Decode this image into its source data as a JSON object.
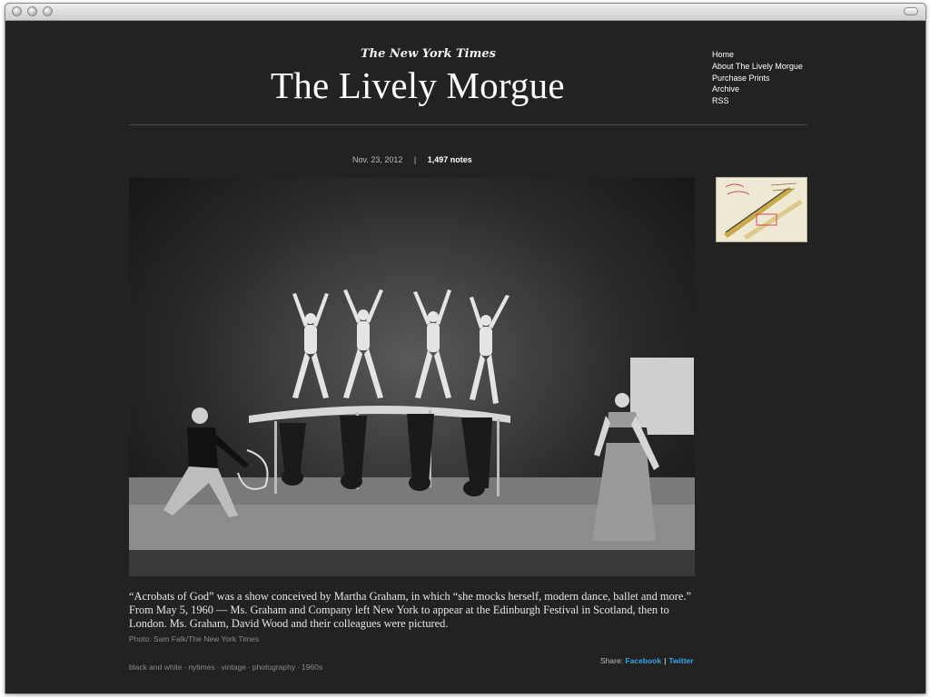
{
  "window": {
    "title": ""
  },
  "header": {
    "logo_text": "The New York Times",
    "site_title": "The Lively Morgue",
    "nav": [
      {
        "label": "Home"
      },
      {
        "label": "About The Lively Morgue"
      },
      {
        "label": "Purchase Prints"
      },
      {
        "label": "Archive"
      },
      {
        "label": "RSS"
      }
    ]
  },
  "post": {
    "date": "Nov. 23, 2012",
    "separator": "|",
    "notes": "1,497 notes",
    "caption": "“Acrobats of God” was a show conceived by Martha Graham, in which “she mocks herself, modern dance, ballet and more.” From May 5, 1960 — Ms. Graham and Company left New York to appear at the Edinburgh Festival in Scotland, then to London. Ms. Graham, David Wood and their colleagues were pictured.",
    "credit": "Photo: Sam Falk/The New York Times",
    "share": {
      "label": "Share:",
      "facebook": "Facebook",
      "divider": "|",
      "twitter": "Twitter"
    },
    "tags": [
      "black and white",
      "nytimes",
      "vintage",
      "photography",
      "1960s"
    ]
  },
  "colors": {
    "page_bg": "#222222",
    "link_blue": "#33a3e8",
    "muted_text": "#8a8a8a"
  }
}
